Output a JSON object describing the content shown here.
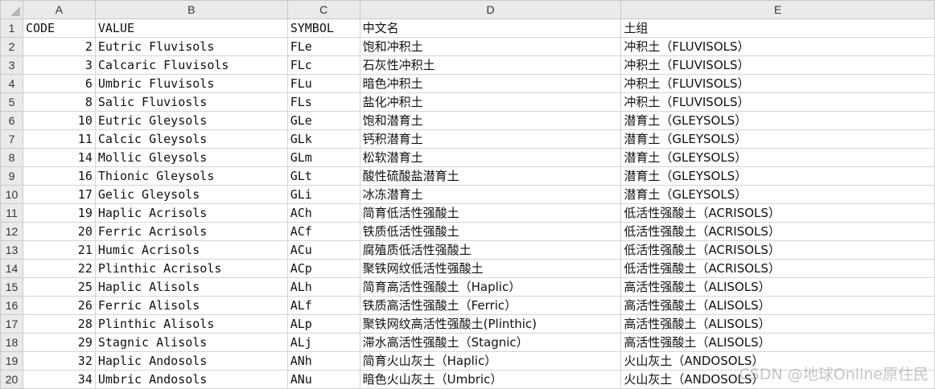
{
  "columns": [
    "A",
    "B",
    "C",
    "D",
    "E"
  ],
  "rows": [
    {
      "n": "1",
      "cells": [
        "CODE",
        "VALUE",
        "SYMBOL",
        "中文名",
        "土组"
      ]
    },
    {
      "n": "2",
      "cells": [
        "2",
        "Eutric Fluvisols",
        "FLe",
        "饱和冲积土",
        "冲积土（FLUVISOLS）"
      ]
    },
    {
      "n": "3",
      "cells": [
        "3",
        "Calcaric Fluvisols",
        "FLc",
        "石灰性冲积土",
        "冲积土（FLUVISOLS）"
      ]
    },
    {
      "n": "4",
      "cells": [
        "6",
        "Umbric Fluvisols",
        "FLu",
        "暗色冲积土",
        "冲积土（FLUVISOLS）"
      ]
    },
    {
      "n": "5",
      "cells": [
        "8",
        "Salic Fluviosls",
        "FLs",
        "盐化冲积土",
        "冲积土（FLUVISOLS）"
      ]
    },
    {
      "n": "6",
      "cells": [
        "10",
        "Eutric Gleysols",
        "GLe",
        "饱和潜育土",
        "潜育土（GLEYSOLS）"
      ]
    },
    {
      "n": "7",
      "cells": [
        "11",
        "Calcic Gleysols",
        "GLk",
        "钙积潜育土",
        "潜育土（GLEYSOLS）"
      ]
    },
    {
      "n": "8",
      "cells": [
        "14",
        "Mollic Gleysols",
        "GLm",
        "松软潜育土",
        "潜育土（GLEYSOLS）"
      ]
    },
    {
      "n": "9",
      "cells": [
        "16",
        "Thionic Gleysols",
        "GLt",
        "酸性硫酸盐潜育土",
        "潜育土（GLEYSOLS）"
      ]
    },
    {
      "n": "10",
      "cells": [
        "17",
        "Gelic Gleysols",
        "GLi",
        "冰冻潜育土",
        "潜育土（GLEYSOLS）"
      ]
    },
    {
      "n": "11",
      "cells": [
        "19",
        "Haplic Acrisols",
        "ACh",
        "简育低活性强酸土",
        "低活性强酸土（ACRISOLS）"
      ]
    },
    {
      "n": "12",
      "cells": [
        "20",
        "Ferric Acrisols",
        "ACf",
        "铁质低活性强酸土",
        "低活性强酸土（ACRISOLS）"
      ]
    },
    {
      "n": "13",
      "cells": [
        "21",
        "Humic Acrisols",
        "ACu",
        "腐殖质低活性强酸土",
        "低活性强酸土（ACRISOLS）"
      ]
    },
    {
      "n": "14",
      "cells": [
        "22",
        "Plinthic Acrisols",
        "ACp",
        "聚铁网纹低活性强酸土",
        "低活性强酸土（ACRISOLS）"
      ]
    },
    {
      "n": "15",
      "cells": [
        "25",
        "Haplic Alisols",
        "ALh",
        "简育高活性强酸土（Haplic）",
        "高活性强酸土（ALISOLS）"
      ]
    },
    {
      "n": "16",
      "cells": [
        "26",
        "Ferric Alisols",
        "ALf",
        "铁质高活性强酸土（Ferric）",
        "高活性强酸土（ALISOLS）"
      ]
    },
    {
      "n": "17",
      "cells": [
        "28",
        "Plinthic Alisols",
        "ALp",
        "聚铁网纹高活性强酸土(Plinthic)",
        "高活性强酸土（ALISOLS）"
      ]
    },
    {
      "n": "18",
      "cells": [
        "29",
        "Stagnic Alisols",
        "ALj",
        "滞水高活性强酸土（Stagnic）",
        "高活性强酸土（ALISOLS）"
      ]
    },
    {
      "n": "19",
      "cells": [
        "32",
        "Haplic Andosols",
        "ANh",
        "简育火山灰土（Haplic）",
        "火山灰土（ANDOSOLS）"
      ]
    },
    {
      "n": "20",
      "cells": [
        "34",
        "Umbric Andosols",
        "ANu",
        "暗色火山灰土（Umbric）",
        "火山灰土（ANDOSOLS）"
      ]
    }
  ],
  "watermark": "CSDN @地球Online原住民"
}
